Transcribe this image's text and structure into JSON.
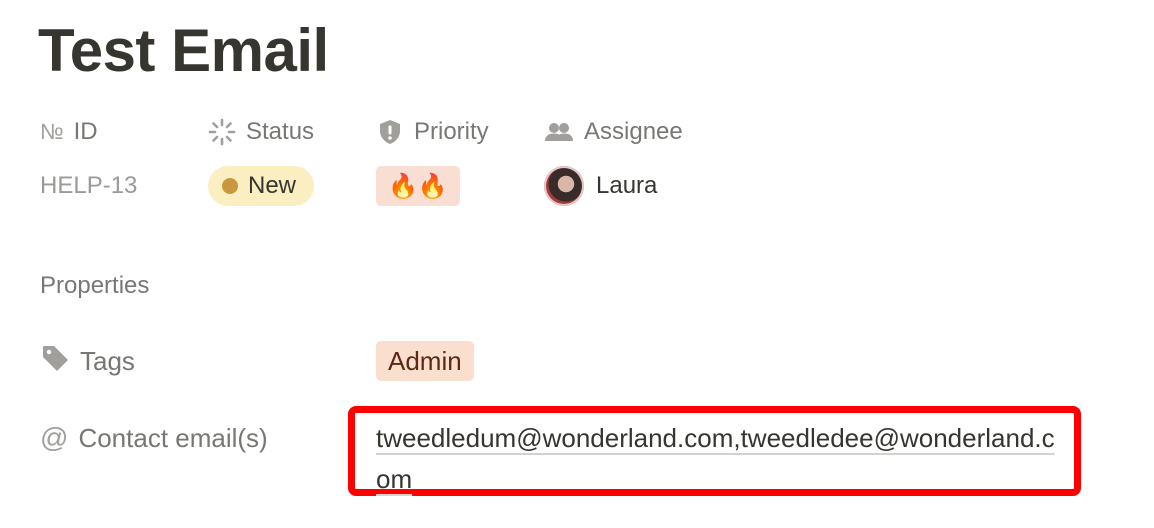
{
  "page": {
    "title": "Test Email"
  },
  "properties_bar": {
    "id": {
      "icon": "number-icon",
      "label": "ID",
      "label_prefix": "№",
      "value": "HELP-13"
    },
    "status": {
      "icon": "status-spinner-icon",
      "label": "Status",
      "value": "New",
      "dot_color": "#c9973d",
      "pill_color": "#fbeec0"
    },
    "priority": {
      "icon": "exclamation-shield-icon",
      "label": "Priority",
      "value": "🔥🔥",
      "pill_color": "#f9dfd3"
    },
    "assignee": {
      "icon": "people-icon",
      "label": "Assignee",
      "value": "Laura",
      "avatar": "avatar-photo"
    }
  },
  "section": {
    "label": "Properties"
  },
  "rows": {
    "tags": {
      "icon": "tag-icon",
      "label": "Tags",
      "value": "Admin",
      "pill_color": "#fadfcf"
    },
    "contact_emails": {
      "icon": "at-icon",
      "label_prefix": "@",
      "label": "Contact email(s)",
      "value": "tweedledum@wonderland.com,tweedledee@wonderland.com",
      "highlight_color": "#ff0000"
    }
  }
}
